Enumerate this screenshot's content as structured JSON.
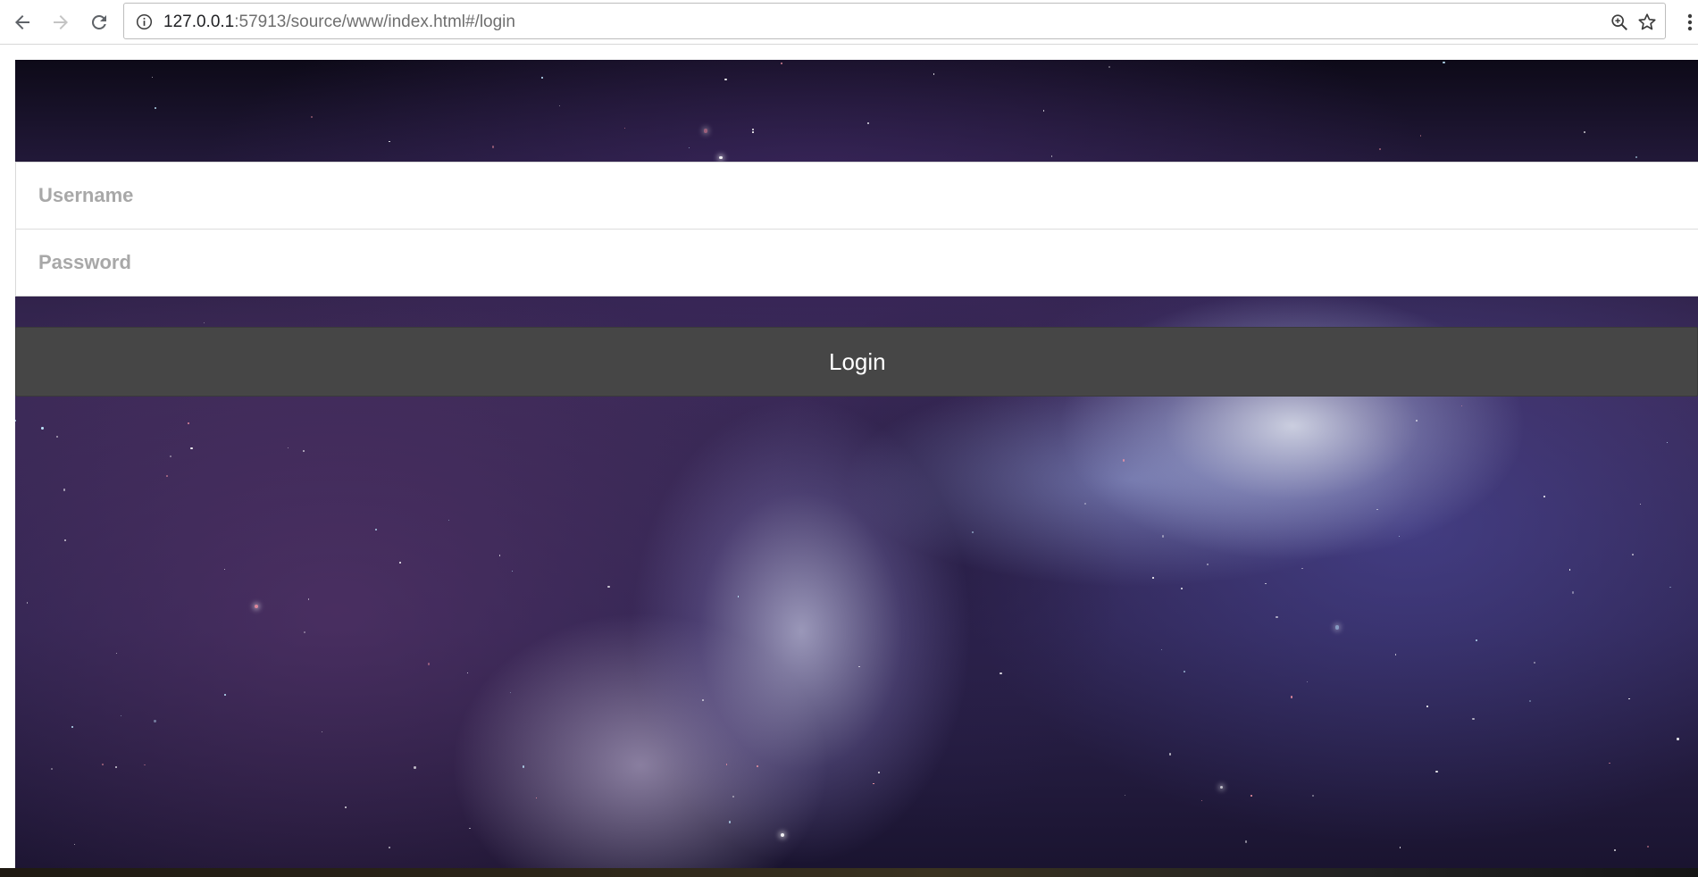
{
  "browser": {
    "url_host": "127.0.0.1",
    "url_rest": ":57913/source/www/index.html#/login",
    "back_icon": "arrow-left-icon",
    "forward_icon": "arrow-right-icon",
    "reload_icon": "reload-icon",
    "info_icon": "info-icon",
    "zoom_icon": "zoom-in-icon",
    "bookmark_icon": "star-icon",
    "menu_icon": "kebab-menu-icon"
  },
  "login_form": {
    "username_placeholder": "Username",
    "username_value": "",
    "password_placeholder": "Password",
    "password_value": "",
    "login_label": "Login"
  },
  "colors": {
    "login_button": "#464646",
    "placeholder": "#a8a8a8",
    "background_theme": "nebula-space"
  }
}
